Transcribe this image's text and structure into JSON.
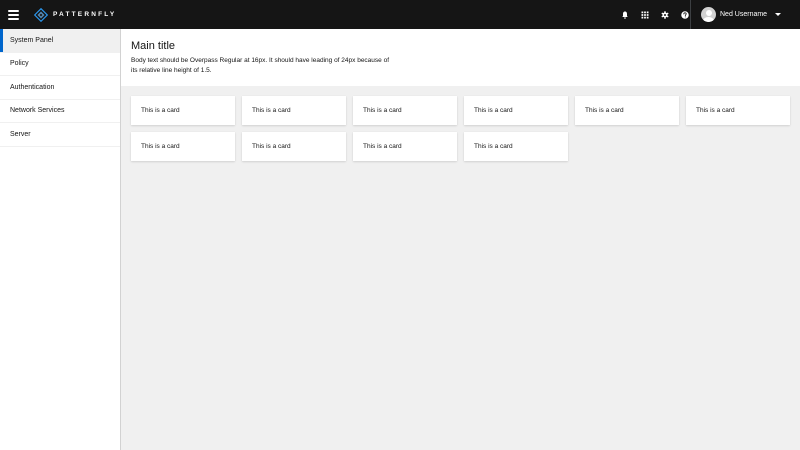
{
  "masthead": {
    "logo_text": "PATTERNFLY",
    "username": "Ned Username",
    "icons": [
      "menu-icon",
      "bell-icon",
      "grid-icon",
      "gear-icon",
      "help-icon",
      "avatar",
      "caret-down-icon"
    ]
  },
  "sidebar": {
    "items": [
      {
        "label": "System Panel",
        "active": true
      },
      {
        "label": "Policy",
        "active": false
      },
      {
        "label": "Authentication",
        "active": false
      },
      {
        "label": "Network Services",
        "active": false
      },
      {
        "label": "Server",
        "active": false
      }
    ]
  },
  "main": {
    "title": "Main title",
    "body": "Body text should be Overpass Regular at 16px. It should have leading of 24px because of its relative line height of 1.5."
  },
  "cards": [
    {
      "label": "This is a card"
    },
    {
      "label": "This is a card"
    },
    {
      "label": "This is a card"
    },
    {
      "label": "This is a card"
    },
    {
      "label": "This is a card"
    },
    {
      "label": "This is a card"
    },
    {
      "label": "This is a card"
    },
    {
      "label": "This is a card"
    },
    {
      "label": "This is a card"
    },
    {
      "label": "This is a card"
    }
  ],
  "colors": {
    "masthead_bg": "#151515",
    "active_accent": "#0066cc",
    "page_bg": "#f0f0f0"
  }
}
